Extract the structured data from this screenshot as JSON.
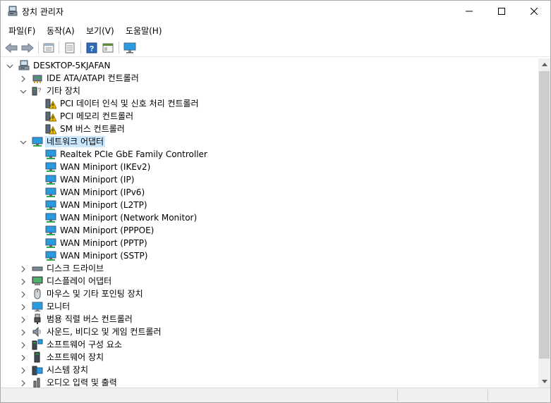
{
  "window": {
    "title": "장치 관리자",
    "controls": {
      "minimize": "minimize",
      "maximize": "maximize",
      "close": "close"
    }
  },
  "menu": {
    "items": [
      "파일(F)",
      "동작(A)",
      "보기(V)",
      "도움말(H)"
    ]
  },
  "toolbar": {
    "buttons": [
      "back-arrow-icon",
      "forward-arrow-icon",
      "properties-icon",
      "update-icon",
      "help-icon",
      "view-icon",
      "monitor-icon"
    ]
  },
  "tree": {
    "root": "DESKTOP-5KJAFAN",
    "nodes": [
      {
        "label": "IDE ATA/ATAPI 컨트롤러",
        "icon": "ide-controller-icon",
        "expanded": false
      },
      {
        "label": "기타 장치",
        "icon": "unknown-device-icon",
        "expanded": true,
        "children": [
          "PCI 데이터 인식 및 신호 처리 컨트롤러",
          "PCI 메모리 컨트롤러",
          "SM 버스 컨트롤러"
        ]
      },
      {
        "label": "네트워크 어댑터",
        "icon": "network-adapter-icon",
        "expanded": true,
        "selected": true,
        "children": [
          "Realtek PCIe GbE Family Controller",
          "WAN Miniport (IKEv2)",
          "WAN Miniport (IP)",
          "WAN Miniport (IPv6)",
          "WAN Miniport (L2TP)",
          "WAN Miniport (Network Monitor)",
          "WAN Miniport (PPPOE)",
          "WAN Miniport (PPTP)",
          "WAN Miniport (SSTP)"
        ]
      },
      {
        "label": "디스크 드라이브",
        "icon": "disk-drive-icon",
        "expanded": false
      },
      {
        "label": "디스플레이 어댑터",
        "icon": "display-adapter-icon",
        "expanded": false
      },
      {
        "label": "마우스 및 기타 포인팅 장치",
        "icon": "mouse-icon",
        "expanded": false
      },
      {
        "label": "모니터",
        "icon": "monitor-icon",
        "expanded": false
      },
      {
        "label": "범용 직렬 버스 컨트롤러",
        "icon": "usb-icon",
        "expanded": false
      },
      {
        "label": "사운드, 비디오 및 게임 컨트롤러",
        "icon": "speaker-icon",
        "expanded": false
      },
      {
        "label": "소프트웨어 구성 요소",
        "icon": "software-component-icon",
        "expanded": false
      },
      {
        "label": "소프트웨어 장치",
        "icon": "software-device-icon",
        "expanded": false
      },
      {
        "label": "시스템 장치",
        "icon": "system-device-icon",
        "expanded": false
      },
      {
        "label": "오디오 입력 및 출력",
        "icon": "audio-io-icon",
        "expanded": false
      }
    ]
  },
  "colors": {
    "selection": "#cce8ff",
    "warning": "#f5c400",
    "network_icon": "#2b9be0",
    "scroll_thumb": "#cdcdcd"
  }
}
